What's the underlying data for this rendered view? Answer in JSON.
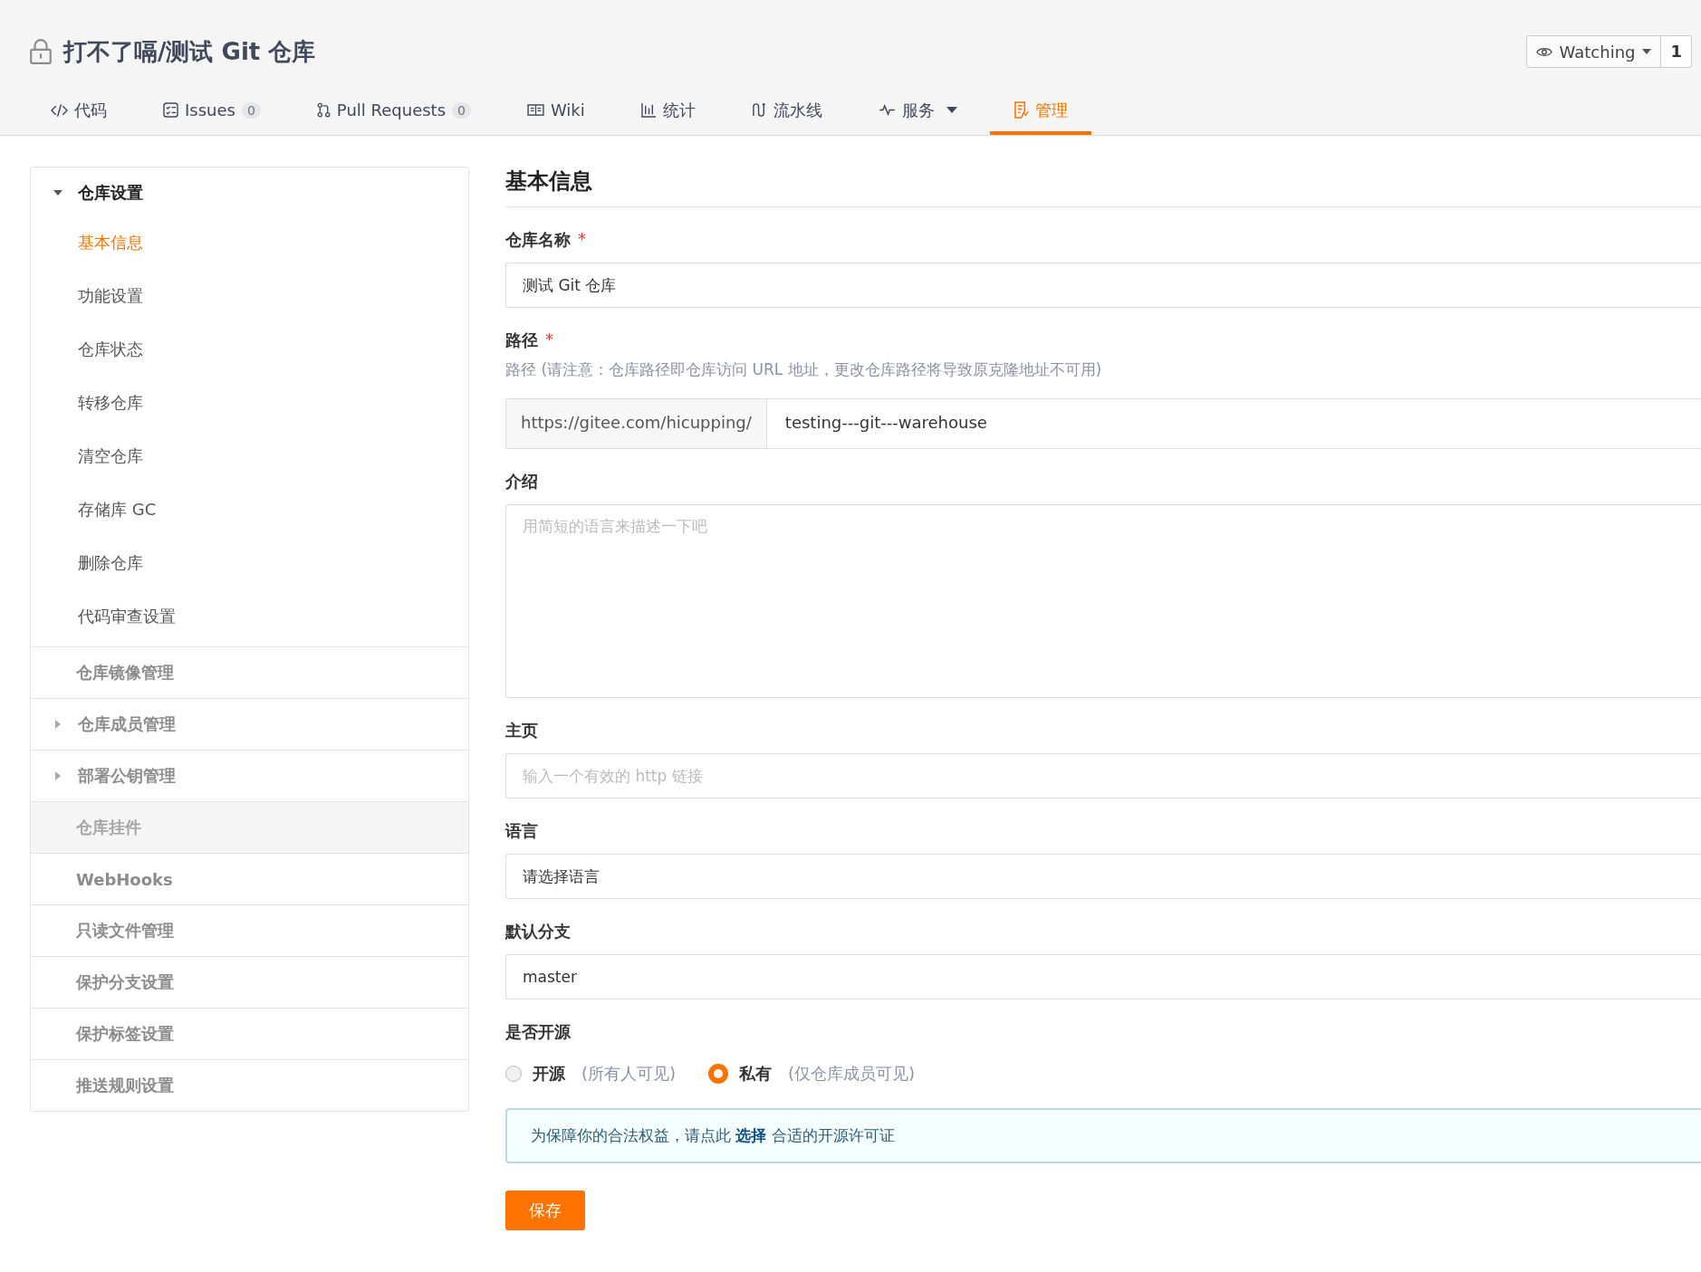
{
  "repo": {
    "title": "打不了嗝/测试 Git 仓库",
    "watch_label": "Watching",
    "watch_count": "1"
  },
  "tabs": [
    {
      "label": "代码",
      "selected": false
    },
    {
      "label": "Issues",
      "count": "0",
      "selected": false
    },
    {
      "label": "Pull Requests",
      "count": "0",
      "selected": false
    },
    {
      "label": "Wiki",
      "selected": false
    },
    {
      "label": "统计",
      "selected": false
    },
    {
      "label": "流水线",
      "selected": false
    },
    {
      "label": "服务",
      "dropdown": true,
      "selected": false
    },
    {
      "label": "管理",
      "selected": true
    }
  ],
  "sidebar": {
    "sections": [
      {
        "label": "仓库设置",
        "kind": "group",
        "expanded": true,
        "selected": false,
        "disabled": false,
        "children": [
          {
            "label": "基本信息",
            "selected": true
          },
          {
            "label": "功能设置",
            "selected": false
          },
          {
            "label": "仓库状态",
            "selected": false
          },
          {
            "label": "转移仓库",
            "selected": false
          },
          {
            "label": "清空仓库",
            "selected": false
          },
          {
            "label": "存储库 GC",
            "selected": false
          },
          {
            "label": "删除仓库",
            "selected": false
          },
          {
            "label": "代码审查设置",
            "selected": false
          }
        ]
      },
      {
        "label": "仓库镜像管理",
        "kind": "link",
        "selected": false,
        "disabled": false
      },
      {
        "label": "仓库成员管理",
        "kind": "group",
        "expanded": false,
        "selected": false,
        "disabled": false
      },
      {
        "label": "部署公钥管理",
        "kind": "group",
        "expanded": false,
        "selected": false,
        "disabled": false
      },
      {
        "label": "仓库挂件",
        "kind": "link",
        "selected": false,
        "disabled": true
      },
      {
        "label": "WebHooks",
        "kind": "link",
        "selected": false,
        "disabled": false
      },
      {
        "label": "只读文件管理",
        "kind": "link",
        "selected": false,
        "disabled": false
      },
      {
        "label": "保护分支设置",
        "kind": "link",
        "selected": false,
        "disabled": false
      },
      {
        "label": "保护标签设置",
        "kind": "link",
        "selected": false,
        "disabled": false
      },
      {
        "label": "推送规则设置",
        "kind": "link",
        "selected": false,
        "disabled": false
      }
    ]
  },
  "form": {
    "title": "基本信息",
    "fields": [
      {
        "kind": "text",
        "label": "仓库名称",
        "required_mark": "*",
        "value": "测试 Git 仓库"
      },
      {
        "kind": "path",
        "label": "路径",
        "required_mark": "*",
        "hint": "路径 (请注意：仓库路径即仓库访问 URL 地址，更改仓库路径将导致原克隆地址不可用)",
        "prefix": "https://gitee.com/hicupping/",
        "value": "testing---git---warehouse"
      },
      {
        "kind": "textarea",
        "label": "介绍",
        "placeholder": "用简短的语言来描述一下吧"
      },
      {
        "kind": "text",
        "label": "主页",
        "placeholder": "输入一个有效的 http 链接"
      },
      {
        "kind": "select",
        "label": "语言",
        "value": "请选择语言"
      },
      {
        "kind": "select",
        "label": "默认分支",
        "value": "master"
      },
      {
        "kind": "radio",
        "label": "是否开源",
        "options": [
          {
            "label": "开源",
            "hint": "(所有人可见)",
            "selected": false
          },
          {
            "label": "私有",
            "hint": "(仅仓库成员可见)",
            "selected": true
          }
        ]
      }
    ],
    "notice": {
      "before": "为保障你的合法权益，请点此 ",
      "link": "选择",
      "after": " 合适的开源许可证"
    },
    "save": "保存"
  }
}
